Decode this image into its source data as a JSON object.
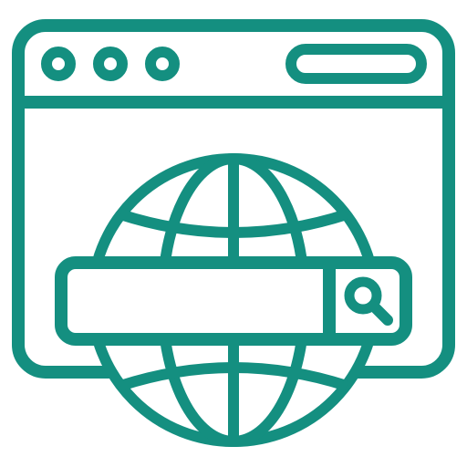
{
  "icon": {
    "name": "web-search-icon",
    "stroke_color": "#148F80",
    "background_color": "#FFFFFF",
    "parts": [
      "browser-window-frame",
      "window-control-dots",
      "address-bar",
      "globe",
      "search-bar",
      "magnifier"
    ]
  }
}
